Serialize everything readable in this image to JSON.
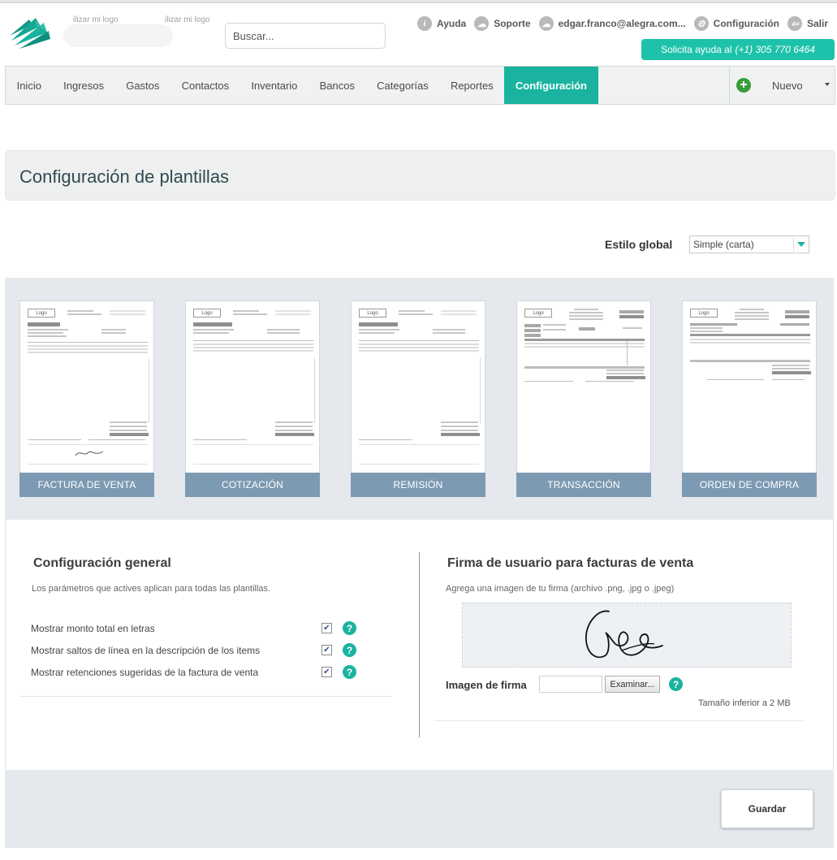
{
  "header": {
    "logo_ghost_text_1": "ilizar mi logo",
    "logo_ghost_text_2": "ilizar mi logo",
    "search_placeholder": "Buscar...",
    "links": [
      {
        "label": "Ayuda",
        "icon": "info-icon"
      },
      {
        "label": "Soporte",
        "icon": "support-icon"
      },
      {
        "label": "edgar.franco@alegra.com...",
        "icon": "user-icon"
      },
      {
        "label": "Configuración",
        "icon": "gear-icon"
      },
      {
        "label": "Salir",
        "icon": "logout-icon"
      }
    ],
    "help_banner_text": "Solicita ayuda al",
    "help_banner_phone": "(+1) 305 770 6464"
  },
  "nav": {
    "items": [
      "Inicio",
      "Ingresos",
      "Gastos",
      "Contactos",
      "Inventario",
      "Bancos",
      "Categorías",
      "Reportes",
      "Configuración"
    ],
    "active": "Configuración",
    "new_label": "Nuevo"
  },
  "page": {
    "title": "Configuración de plantillas",
    "global_style_label": "Estilo global",
    "global_style_value": "Simple (carta)"
  },
  "templates": [
    {
      "label": "FACTURA DE VENTA",
      "logo": "Logo"
    },
    {
      "label": "COTIZACIÓN",
      "logo": "Logo"
    },
    {
      "label": "REMISIÓN",
      "logo": "Logo"
    },
    {
      "label": "TRANSACCIÓN",
      "logo": "Logo"
    },
    {
      "label": "ORDEN DE COMPRA",
      "logo": "Logo"
    }
  ],
  "general_config": {
    "title": "Configuración general",
    "description": "Los parámetros que actives aplican para todas las plantillas.",
    "options": [
      {
        "label": "Mostrar monto total en letras",
        "checked": true
      },
      {
        "label": "Mostrar saltos de línea en la descripción de los items",
        "checked": true
      },
      {
        "label": "Mostrar retenciones sugeridas de la factura de venta",
        "checked": true
      }
    ]
  },
  "signature": {
    "title": "Firma de usuario para facturas de venta",
    "description": "Agrega una imagen de tu firma (archivo .png, .jpg o .jpeg)",
    "file_label": "Imagen de firma",
    "browse_button": "Examinar...",
    "size_note": "Tamaño inferior a 2 MB"
  },
  "footer": {
    "save_button": "Guardar"
  },
  "colors": {
    "accent": "#1ab3a0",
    "template_label_bg": "#7d9ab3",
    "panel_bg": "#e5e9ee"
  }
}
